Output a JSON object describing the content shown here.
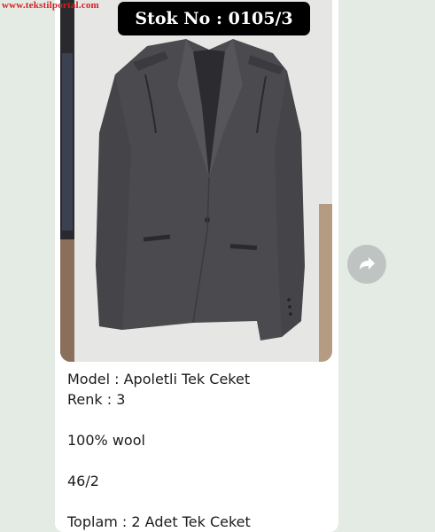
{
  "watermark": "www.tekstilportal.com",
  "badge": {
    "text": "Stok No : 0105/3"
  },
  "caption": {
    "model": "Model : Apoletli Tek Ceket",
    "renk": "Renk : 3",
    "material": "100% wool",
    "size": "46/2",
    "total": "Toplam : 2 Adet Tek Ceket"
  },
  "forward_button": {
    "icon": "forward-share-icon"
  },
  "colors": {
    "chat_background": "#e4eae4",
    "bubble": "#ffffff",
    "badge": "#000000",
    "watermark": "#d61f1f",
    "forward_button": "#bfc4c2"
  }
}
